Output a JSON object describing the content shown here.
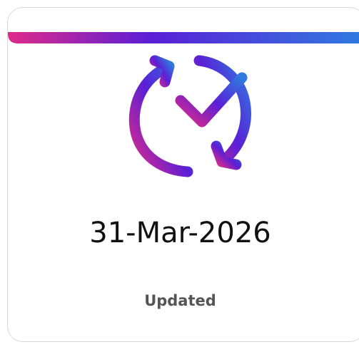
{
  "card": {
    "date": "31-Mar-2026",
    "status": "Updated",
    "icon": "refresh-check-icon",
    "accent_colors": [
      "#e02a8a",
      "#5a1fd6",
      "#2a78e0"
    ]
  }
}
